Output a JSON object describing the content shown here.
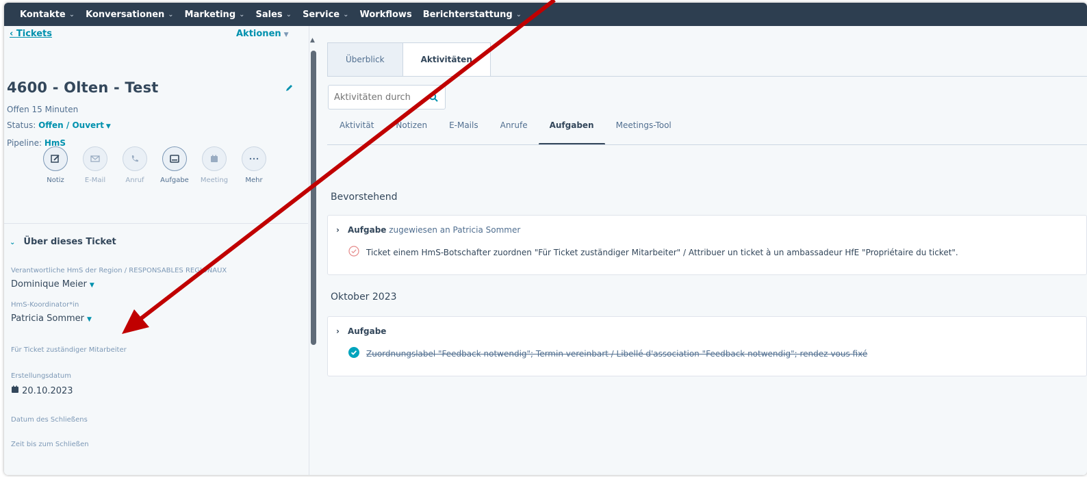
{
  "topnav": {
    "items": [
      {
        "label": "Kontakte",
        "dropdown": true
      },
      {
        "label": "Konversationen",
        "dropdown": true
      },
      {
        "label": "Marketing",
        "dropdown": true
      },
      {
        "label": "Sales",
        "dropdown": true
      },
      {
        "label": "Service",
        "dropdown": true
      },
      {
        "label": "Workflows",
        "dropdown": false
      },
      {
        "label": "Berichterstattung",
        "dropdown": true
      }
    ]
  },
  "sidebar": {
    "back_label": "Tickets",
    "actions_label": "Aktionen",
    "ticket_title": "4600 - Olten - Test",
    "open_duration": "Offen 15 Minuten",
    "status_label": "Status:",
    "status_value": "Offen / Ouvert",
    "pipeline_label": "Pipeline:",
    "pipeline_value": "HmS",
    "activity_buttons": [
      {
        "label": "Notiz",
        "icon": "note-icon"
      },
      {
        "label": "E-Mail",
        "icon": "email-icon"
      },
      {
        "label": "Anruf",
        "icon": "phone-icon"
      },
      {
        "label": "Aufgabe",
        "icon": "task-icon"
      },
      {
        "label": "Meeting",
        "icon": "calendar-icon"
      },
      {
        "label": "Mehr",
        "icon": "more-icon"
      }
    ],
    "section_title": "Über dieses Ticket",
    "fields": {
      "regional_label": "Verantwortliche HmS der Region / RESPONSABLES REGIONAUX",
      "regional_value": "Dominique Meier",
      "coordinator_label": "HmS-Koordinator*in",
      "coordinator_value": "Patricia Sommer",
      "owner_label": "Für Ticket zuständiger Mitarbeiter",
      "created_label": "Erstellungsdatum",
      "created_value": "20.10.2023",
      "close_date_label": "Datum des Schließens",
      "time_to_close_label": "Zeit bis zum Schließen"
    }
  },
  "main": {
    "tabs": [
      {
        "label": "Überblick",
        "active": false
      },
      {
        "label": "Aktivitäten",
        "active": true
      }
    ],
    "search_placeholder": "Aktivitäten durch",
    "subtabs": [
      {
        "label": "Aktivität",
        "active": false
      },
      {
        "label": "Notizen",
        "active": false
      },
      {
        "label": "E-Mails",
        "active": false
      },
      {
        "label": "Anrufe",
        "active": false
      },
      {
        "label": "Aufgaben",
        "active": true
      },
      {
        "label": "Meetings-Tool",
        "active": false
      }
    ],
    "upcoming": {
      "heading": "Bevorstehend",
      "card_type": "Aufgabe",
      "card_assignee": "zugewiesen an Patricia Sommer",
      "task_text": "Ticket einem HmS-Botschafter zuordnen \"Für Ticket zuständiger Mitarbeiter\" / Attribuer un ticket à un ambassadeur HfE \"Propriétaire du ticket\".",
      "completed": false
    },
    "october": {
      "heading": "Oktober 2023",
      "card_type": "Aufgabe",
      "task_text": "Zuordnungslabel \"Feedback notwendig\"; Termin vereinbart / Libellé d'association \"Feedback notwendig\"; rendez-vous fixé",
      "completed": true
    }
  },
  "colors": {
    "nav_bg": "#2d3e50",
    "link": "#0091ae",
    "success": "#00a4bd",
    "arrow": "#c00000"
  }
}
